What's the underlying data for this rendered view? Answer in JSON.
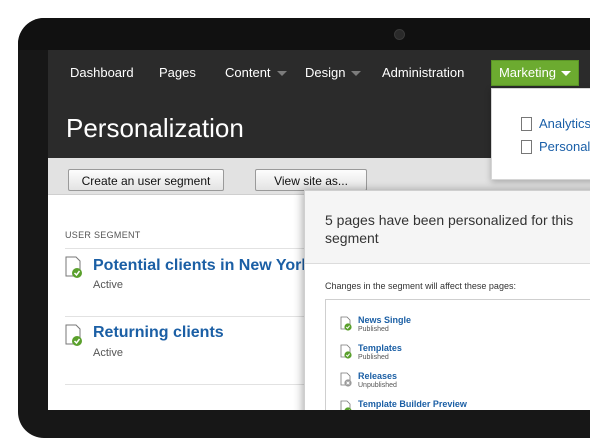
{
  "nav": {
    "items": [
      {
        "label": "Dashboard"
      },
      {
        "label": "Pages"
      },
      {
        "label": "Content"
      },
      {
        "label": "Design"
      },
      {
        "label": "Administration"
      }
    ],
    "marketing_label": "Marketing"
  },
  "dropdown": {
    "items": [
      {
        "label": "Analytics",
        "icon": "document-icon"
      },
      {
        "label": "Personal",
        "icon": "document-icon"
      }
    ]
  },
  "page": {
    "title": "Personalization"
  },
  "toolbar": {
    "create_label": "Create an user segment",
    "view_label": "View site as..."
  },
  "segments": {
    "header": "USER SEGMENT",
    "items": [
      {
        "title": "Potential clients in New York",
        "status": "Active"
      },
      {
        "title": "Returning clients",
        "status": "Active"
      }
    ]
  },
  "popup": {
    "title": "5 pages have been personalized for this segment",
    "subtitle": "Changes in the segment will affect these pages:",
    "pages": [
      {
        "title": "News Single",
        "status": "Published",
        "state": "ok"
      },
      {
        "title": "Templates",
        "status": "Published",
        "state": "ok"
      },
      {
        "title": "Releases",
        "status": "Unpublished",
        "state": "off"
      },
      {
        "title": "Template Builder Preview",
        "status": "",
        "state": "ok"
      }
    ]
  },
  "colors": {
    "header_bg": "#2b2b2b",
    "marketing_green": "#6cab30",
    "link_blue": "#1b5fa5",
    "check_green": "#5aa02c"
  }
}
